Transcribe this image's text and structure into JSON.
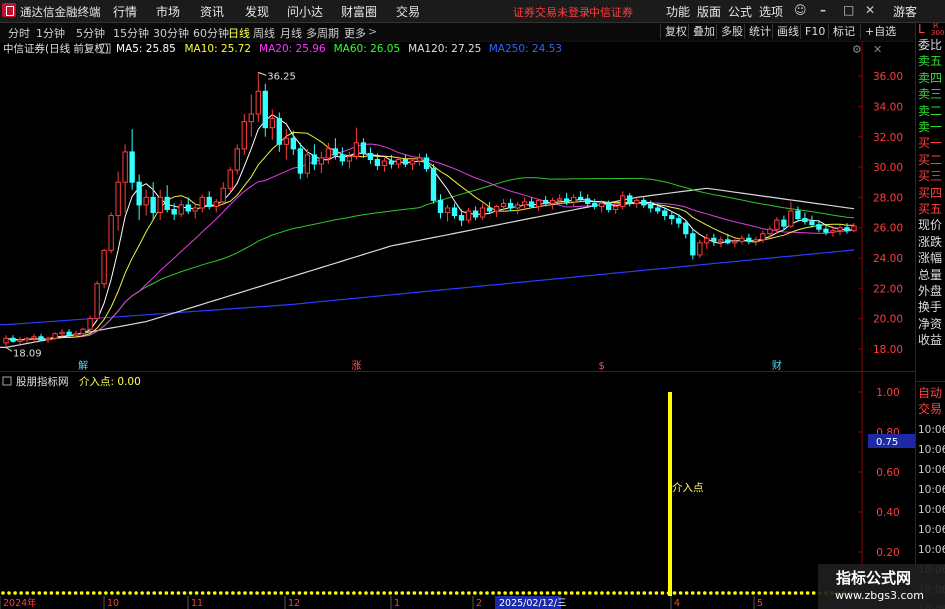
{
  "app": {
    "title": "通达信金融终端"
  },
  "menu": [
    "行情",
    "市场",
    "资讯",
    "发现",
    "问小达",
    "财富圈",
    "交易"
  ],
  "trade_tip": "证券交易未登录",
  "broker": "中信证券",
  "right_menu": [
    "功能",
    "版面",
    "公式",
    "选项"
  ],
  "guest": "游客",
  "periods": [
    "分时",
    "1分钟",
    "5分钟",
    "15分钟",
    "30分钟",
    "60分钟",
    "日线",
    "周线",
    "月线",
    "多周期",
    "更多"
  ],
  "active_period": "日线",
  "toolbar": [
    "复权",
    "叠加",
    "多股",
    "统计",
    "画线",
    "F10",
    "标记",
    "+自选"
  ],
  "stock_info": {
    "name": "中信证券(日线 前复权)"
  },
  "ma_legend": [
    {
      "label": "MA5: 25.85",
      "color": "#ffffff"
    },
    {
      "label": "MA10: 25.72",
      "color": "#ffff33"
    },
    {
      "label": "MA20: 25.96",
      "color": "#ff33ff"
    },
    {
      "label": "MA60: 26.05",
      "color": "#33ff33"
    },
    {
      "label": "MA120: 27.25",
      "color": "#e0e0e0"
    },
    {
      "label": "MA250: 24.53",
      "color": "#3366ff"
    }
  ],
  "price_axis": [
    "36.00",
    "34.00",
    "32.00",
    "30.00",
    "28.00",
    "26.00",
    "24.00",
    "22.00",
    "20.00",
    "18.00"
  ],
  "high_label": "36.25",
  "low_label": "18.09",
  "markers": [
    "解",
    "涨",
    "$",
    "财"
  ],
  "indicator": {
    "name": "股朋指标网",
    "label": "介入点: 0.00",
    "signal_text": "介入点"
  },
  "indicator_axis": [
    "1.00",
    "0.80",
    "0.60",
    "0.40",
    "0.20"
  ],
  "indicator_current": "0.75",
  "time_axis": [
    "2024年",
    "10",
    "11",
    "12",
    "1",
    "2",
    "2025/02/12/三",
    "4",
    "5"
  ],
  "right_panel": {
    "corner": "L",
    "corner_sub": "R",
    "corner_num": "300",
    "labels": [
      "委比",
      "卖五",
      "卖四",
      "卖三",
      "卖二",
      "卖一",
      "买一",
      "买二",
      "买三",
      "买四",
      "买五",
      "现价",
      "涨跌",
      "涨幅",
      "总量",
      "外盘",
      "换手",
      "净资",
      "收益"
    ],
    "auto_trade": [
      "自动",
      "交易"
    ],
    "times": [
      "10:06",
      "10:06",
      "10:06",
      "10:06",
      "10:06",
      "10:06",
      "10:06",
      "10:06",
      "10:06",
      "10:06"
    ]
  },
  "watermark": {
    "title": "指标公式网",
    "url": "www.zbgs3.com"
  },
  "colors": {
    "up": "#ff3c3c",
    "down": "#33ffff",
    "grid": "#8a0000",
    "signal": "#ffff00",
    "axis_text": "#ff3c3c"
  },
  "chart_data": {
    "type": "candlestick",
    "price_range": [
      17.2,
      37.0
    ],
    "candles": [
      [
        18.4,
        18.9,
        18.1,
        18.7
      ],
      [
        18.7,
        18.9,
        18.4,
        18.5
      ],
      [
        18.5,
        18.8,
        18.3,
        18.6
      ],
      [
        18.6,
        18.8,
        18.4,
        18.7
      ],
      [
        18.7,
        19.0,
        18.5,
        18.8
      ],
      [
        18.8,
        19.0,
        18.5,
        18.6
      ],
      [
        18.6,
        18.8,
        18.4,
        18.7
      ],
      [
        18.7,
        19.1,
        18.6,
        19.0
      ],
      [
        19.0,
        19.3,
        18.8,
        19.1
      ],
      [
        19.1,
        19.3,
        18.8,
        18.9
      ],
      [
        18.9,
        19.2,
        18.7,
        19.0
      ],
      [
        19.0,
        19.4,
        18.9,
        19.3
      ],
      [
        19.3,
        20.2,
        19.2,
        20.0
      ],
      [
        20.0,
        22.5,
        19.9,
        22.3
      ],
      [
        22.3,
        24.6,
        22.0,
        24.5
      ],
      [
        24.5,
        27.0,
        24.3,
        26.8
      ],
      [
        26.8,
        29.7,
        25.8,
        29.0
      ],
      [
        29.0,
        31.5,
        27.0,
        31.0
      ],
      [
        31.0,
        32.5,
        28.5,
        29.0
      ],
      [
        29.0,
        29.5,
        26.5,
        27.5
      ],
      [
        27.5,
        28.5,
        26.8,
        28.0
      ],
      [
        28.0,
        29.0,
        26.5,
        27.0
      ],
      [
        27.0,
        28.5,
        26.5,
        28.0
      ],
      [
        28.0,
        28.8,
        27.0,
        27.2
      ],
      [
        27.2,
        27.6,
        26.5,
        26.9
      ],
      [
        26.9,
        27.8,
        26.7,
        27.5
      ],
      [
        27.5,
        28.0,
        26.9,
        27.1
      ],
      [
        27.1,
        27.6,
        26.6,
        27.3
      ],
      [
        27.3,
        28.2,
        27.0,
        28.0
      ],
      [
        28.0,
        28.4,
        27.2,
        27.4
      ],
      [
        27.4,
        27.9,
        27.0,
        27.7
      ],
      [
        27.7,
        29.0,
        27.5,
        28.6
      ],
      [
        28.6,
        30.0,
        28.3,
        29.8
      ],
      [
        29.8,
        31.5,
        29.5,
        31.2
      ],
      [
        31.2,
        33.5,
        30.8,
        33.0
      ],
      [
        33.0,
        34.8,
        32.0,
        33.5
      ],
      [
        33.5,
        36.25,
        33.0,
        35.0
      ],
      [
        35.0,
        35.5,
        32.0,
        32.6
      ],
      [
        32.6,
        33.8,
        31.8,
        33.2
      ],
      [
        33.2,
        33.6,
        31.0,
        31.5
      ],
      [
        31.5,
        32.5,
        30.5,
        31.9
      ],
      [
        31.9,
        32.4,
        30.8,
        31.2
      ],
      [
        31.2,
        31.6,
        29.2,
        29.6
      ],
      [
        29.6,
        31.2,
        29.3,
        30.8
      ],
      [
        30.8,
        31.5,
        29.8,
        30.2
      ],
      [
        30.2,
        31.0,
        29.6,
        30.6
      ],
      [
        30.6,
        31.6,
        30.2,
        31.2
      ],
      [
        31.2,
        31.9,
        30.5,
        30.8
      ],
      [
        30.8,
        31.3,
        30.1,
        30.4
      ],
      [
        30.4,
        31.0,
        29.9,
        30.7
      ],
      [
        30.7,
        32.6,
        30.5,
        31.6
      ],
      [
        31.6,
        31.9,
        30.6,
        30.9
      ],
      [
        30.9,
        31.3,
        30.2,
        30.5
      ],
      [
        30.5,
        30.9,
        29.8,
        30.1
      ],
      [
        30.1,
        30.6,
        29.7,
        30.4
      ],
      [
        30.4,
        30.8,
        29.9,
        30.2
      ],
      [
        30.2,
        30.7,
        29.9,
        30.5
      ],
      [
        30.5,
        30.8,
        30.0,
        30.2
      ],
      [
        30.2,
        30.6,
        29.8,
        30.4
      ],
      [
        30.4,
        30.9,
        30.1,
        30.6
      ],
      [
        30.6,
        30.9,
        29.7,
        29.9
      ],
      [
        29.9,
        30.2,
        27.6,
        27.8
      ],
      [
        27.8,
        28.2,
        26.6,
        27.0
      ],
      [
        27.0,
        27.5,
        26.4,
        27.3
      ],
      [
        27.3,
        27.6,
        26.6,
        26.8
      ],
      [
        26.8,
        27.2,
        26.1,
        26.5
      ],
      [
        26.5,
        27.3,
        26.3,
        27.1
      ],
      [
        27.1,
        27.4,
        26.5,
        26.7
      ],
      [
        26.7,
        27.6,
        26.5,
        27.3
      ],
      [
        27.3,
        27.7,
        26.9,
        27.1
      ],
      [
        27.1,
        27.5,
        26.7,
        27.4
      ],
      [
        27.4,
        27.9,
        27.1,
        27.6
      ],
      [
        27.6,
        27.9,
        27.1,
        27.3
      ],
      [
        27.3,
        27.7,
        26.9,
        27.5
      ],
      [
        27.5,
        28.0,
        27.2,
        27.7
      ],
      [
        27.7,
        28.0,
        27.3,
        27.4
      ],
      [
        27.4,
        27.9,
        27.1,
        27.8
      ],
      [
        27.8,
        28.1,
        27.4,
        27.6
      ],
      [
        27.6,
        28.0,
        27.2,
        27.8
      ],
      [
        27.8,
        28.2,
        27.5,
        27.9
      ],
      [
        27.9,
        28.3,
        27.5,
        27.7
      ],
      [
        27.7,
        28.2,
        27.4,
        28.0
      ],
      [
        28.0,
        28.4,
        27.7,
        27.9
      ],
      [
        27.9,
        28.2,
        27.4,
        27.6
      ],
      [
        27.6,
        27.9,
        27.2,
        27.4
      ],
      [
        27.4,
        27.8,
        27.0,
        27.6
      ],
      [
        27.6,
        27.8,
        27.0,
        27.2
      ],
      [
        27.2,
        27.6,
        26.9,
        27.4
      ],
      [
        27.4,
        28.4,
        27.2,
        28.1
      ],
      [
        28.1,
        28.3,
        27.4,
        27.6
      ],
      [
        27.6,
        28.0,
        27.3,
        27.8
      ],
      [
        27.8,
        28.0,
        27.3,
        27.5
      ],
      [
        27.5,
        27.8,
        27.0,
        27.3
      ],
      [
        27.3,
        27.6,
        26.9,
        27.1
      ],
      [
        27.1,
        27.3,
        26.5,
        26.8
      ],
      [
        26.8,
        27.1,
        26.2,
        26.6
      ],
      [
        26.6,
        26.9,
        26.0,
        26.3
      ],
      [
        26.3,
        26.5,
        25.3,
        25.6
      ],
      [
        25.6,
        25.9,
        23.9,
        24.2
      ],
      [
        24.2,
        25.2,
        24.0,
        25.0
      ],
      [
        25.0,
        25.6,
        24.6,
        25.3
      ],
      [
        25.3,
        25.6,
        24.8,
        25.1
      ],
      [
        25.1,
        25.4,
        24.7,
        25.2
      ],
      [
        25.2,
        25.6,
        24.9,
        25.0
      ],
      [
        25.0,
        25.3,
        24.7,
        25.1
      ],
      [
        25.1,
        25.5,
        24.9,
        25.3
      ],
      [
        25.3,
        25.6,
        24.9,
        25.1
      ],
      [
        25.1,
        25.4,
        24.8,
        25.2
      ],
      [
        25.2,
        25.8,
        25.0,
        25.6
      ],
      [
        25.6,
        26.1,
        25.3,
        25.9
      ],
      [
        25.9,
        26.7,
        25.6,
        26.5
      ],
      [
        26.5,
        26.8,
        25.9,
        26.1
      ],
      [
        26.1,
        27.7,
        26.0,
        27.1
      ],
      [
        27.1,
        27.4,
        26.4,
        26.6
      ],
      [
        26.6,
        27.0,
        26.2,
        26.4
      ],
      [
        26.4,
        26.8,
        26.0,
        26.2
      ],
      [
        26.2,
        26.5,
        25.7,
        25.9
      ],
      [
        25.9,
        26.2,
        25.5,
        25.7
      ],
      [
        25.7,
        26.1,
        25.4,
        25.8
      ],
      [
        25.8,
        26.2,
        25.5,
        26.0
      ],
      [
        26.0,
        26.3,
        25.6,
        25.8
      ],
      [
        25.8,
        26.3,
        25.7,
        26.1
      ]
    ],
    "series_anchor_values": {
      "MA250": [
        [
          0,
          19.6
        ],
        [
          40,
          20.9
        ],
        [
          121,
          24.53
        ]
      ],
      "MA120": [
        [
          0,
          18.1
        ],
        [
          20,
          19.8
        ],
        [
          55,
          24.8
        ],
        [
          90,
          28.0
        ],
        [
          100,
          28.6
        ],
        [
          121,
          27.25
        ]
      ]
    },
    "signal": {
      "index": 100,
      "value": 1.0
    }
  }
}
